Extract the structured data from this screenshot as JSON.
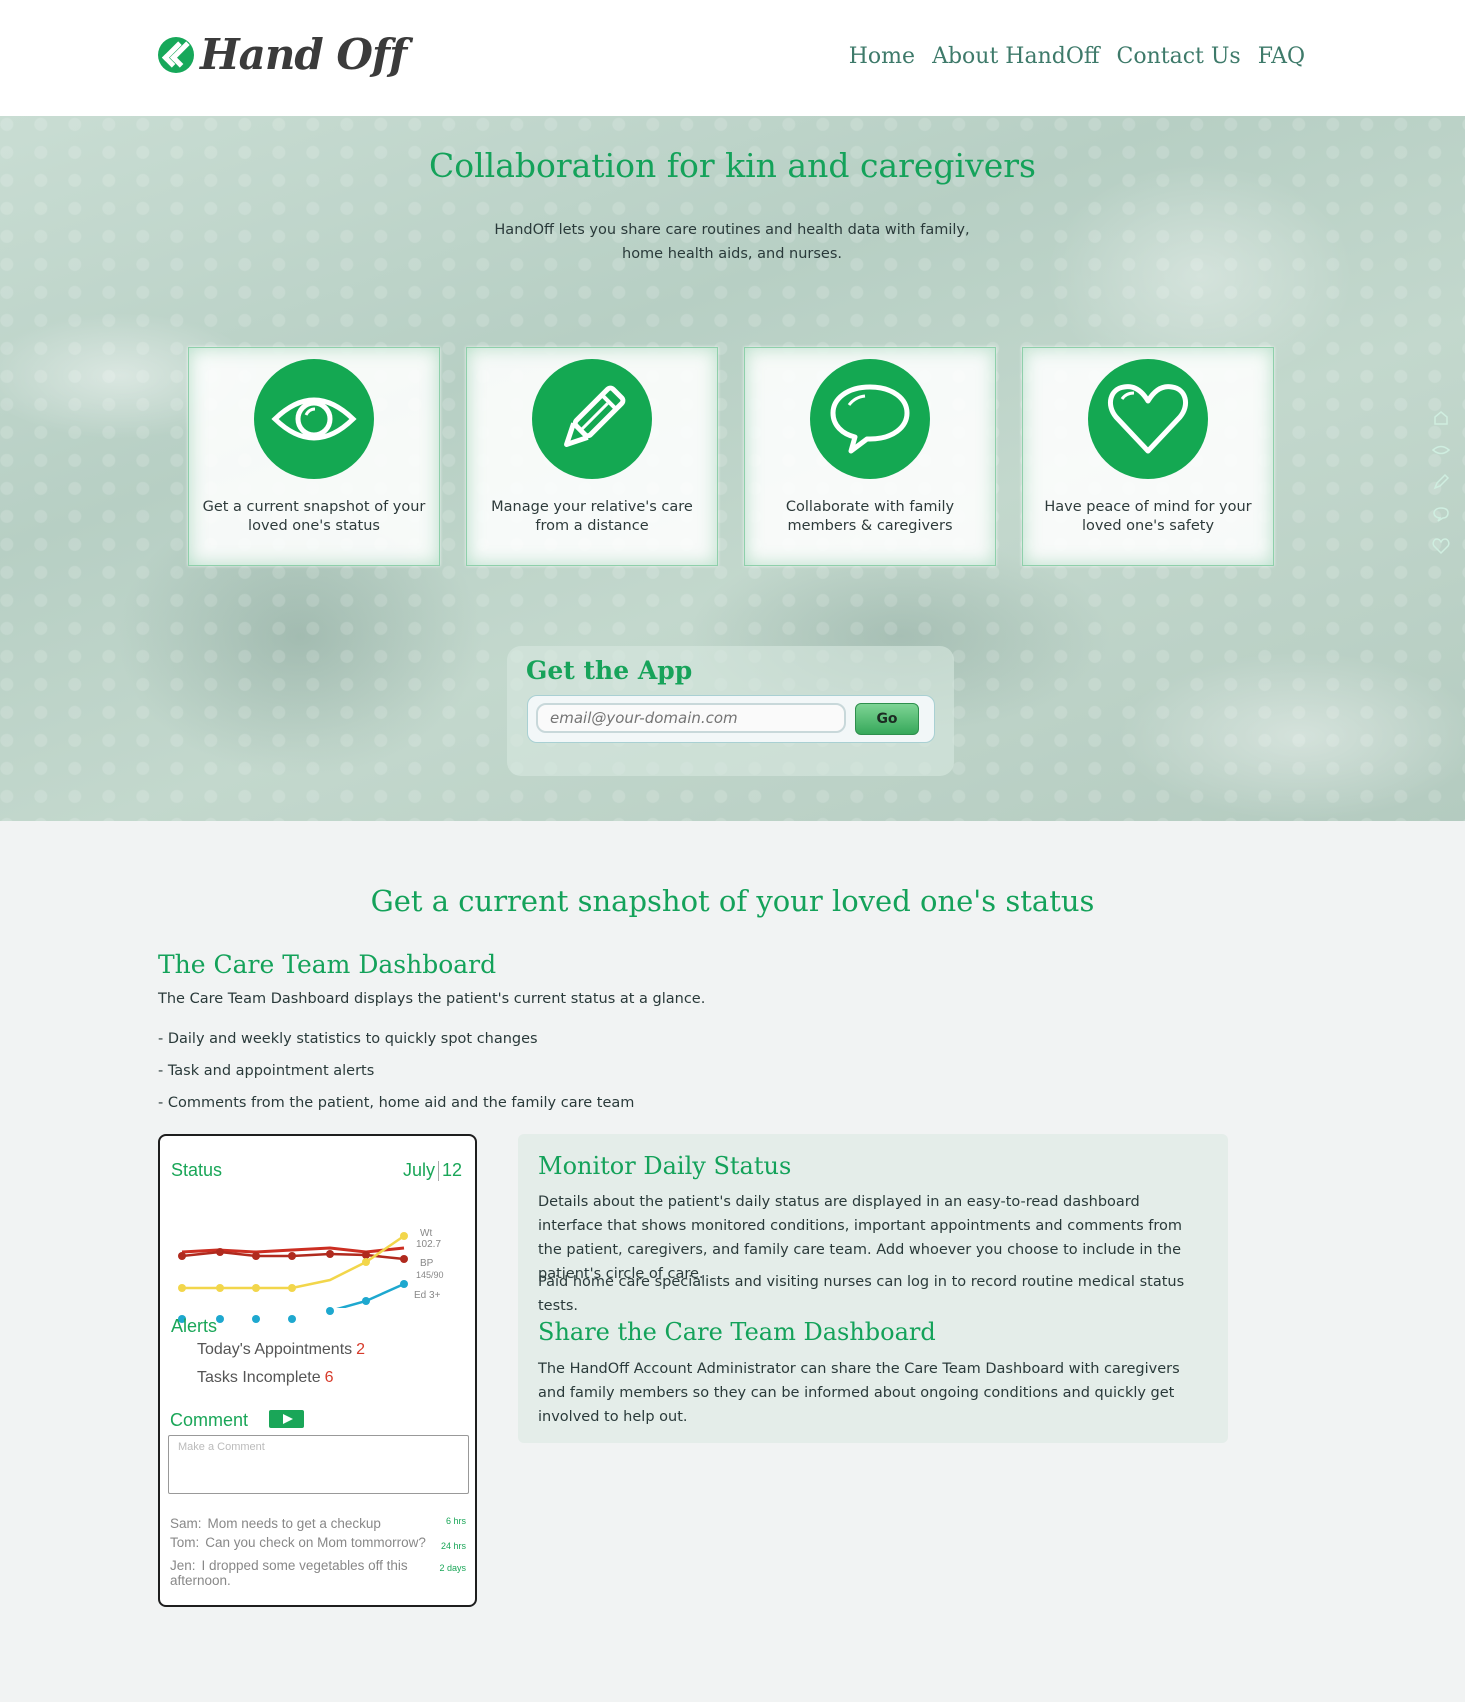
{
  "header": {
    "logo_text": "Hand Off",
    "nav": [
      "Home",
      "About HandOff",
      "Contact Us",
      "FAQ"
    ]
  },
  "hero": {
    "title": "Collaboration for kin and caregivers",
    "subtitle": "HandOff lets you share care routines and health data with family, home health aids, and nurses.",
    "features": [
      {
        "icon": "eye-icon",
        "text": "Get a current snapshot of your loved one's status"
      },
      {
        "icon": "pencil-icon",
        "text": "Manage your relative's care from a distance"
      },
      {
        "icon": "speech-bubble-icon",
        "text": "Collaborate with family members & caregivers"
      },
      {
        "icon": "heart-icon",
        "text": "Have peace of mind for your loved one's safety"
      }
    ],
    "get_app": {
      "title": "Get the App",
      "placeholder": "email@your-domain.com",
      "button": "Go"
    }
  },
  "snapshot": {
    "section_title": "Get a current snapshot of your loved one's status",
    "dashboard_title": "The Care Team Dashboard",
    "dashboard_desc": "The Care Team Dashboard displays the patient's current status at a glance.",
    "bullets": [
      "- Daily and weekly statistics to quickly spot changes",
      "- Task and appointment alerts",
      "- Comments from the patient, home aid and the family care team"
    ]
  },
  "phone": {
    "status_label": "Status",
    "month": "July",
    "day": "12",
    "chart_labels": {
      "wt": "Wt",
      "wt_val": "102.7",
      "bp": "BP",
      "bp_val": "145/90",
      "ed": "Ed 3+"
    },
    "alerts_label": "Alerts",
    "appointments_label": "Today's Appointments",
    "appointments_count": "2",
    "tasks_label": "Tasks Incomplete",
    "tasks_count": "6",
    "comment_label": "Comment",
    "comment_placeholder": "Make a Comment",
    "messages": [
      {
        "who": "Sam:",
        "text": "Mom needs to get a checkup",
        "ago": "6 hrs"
      },
      {
        "who": "Tom:",
        "text": "Can you check on Mom tommorrow?",
        "ago": "24 hrs"
      },
      {
        "who": "Jen:",
        "text": "I dropped some vegetables off this afternoon.",
        "ago": "2 days"
      }
    ]
  },
  "info": {
    "monitor_title": "Monitor Daily Status",
    "monitor_p1": "Details about the patient's daily status are displayed in an easy-to-read dashboard interface that shows monitored conditions, important appointments and comments from the patient, caregivers, and family care team. Add whoever you choose to include in the patient's circle of care.",
    "monitor_p2": "Paid home care specialists and visiting nurses can log in to record routine medical status tests.",
    "share_title": "Share the Care Team Dashboard",
    "share_p": "The HandOff Account Administrator can share the Care Team Dashboard with caregivers and family members so they can be informed about ongoing conditions and quickly get involved to help out."
  },
  "colors": {
    "accent": "#14a852",
    "heading": "#14a25a",
    "nav": "#3e7a6a",
    "alert": "#d63a2a"
  }
}
